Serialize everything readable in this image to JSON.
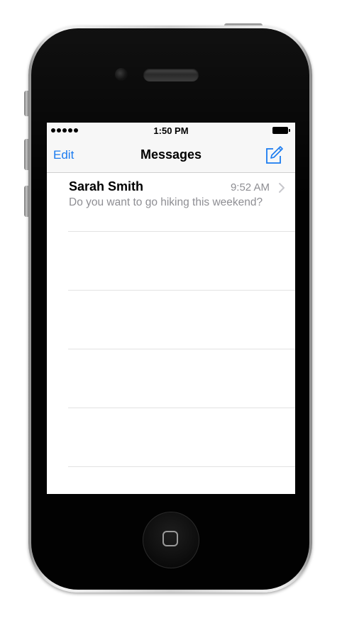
{
  "status_bar": {
    "time": "1:50 PM",
    "signal_icon": "signal-dots-icon",
    "battery_icon": "battery-full-icon"
  },
  "nav": {
    "edit_label": "Edit",
    "title": "Messages",
    "compose_icon": "compose-icon"
  },
  "conversations": [
    {
      "name": "Sarah Smith",
      "time": "9:52 AM",
      "preview": "Do you want to go hiking this weekend?"
    }
  ],
  "colors": {
    "accent": "#1a7bf0",
    "secondary_text": "#8e8e93",
    "bar_background": "#f7f7f7"
  }
}
